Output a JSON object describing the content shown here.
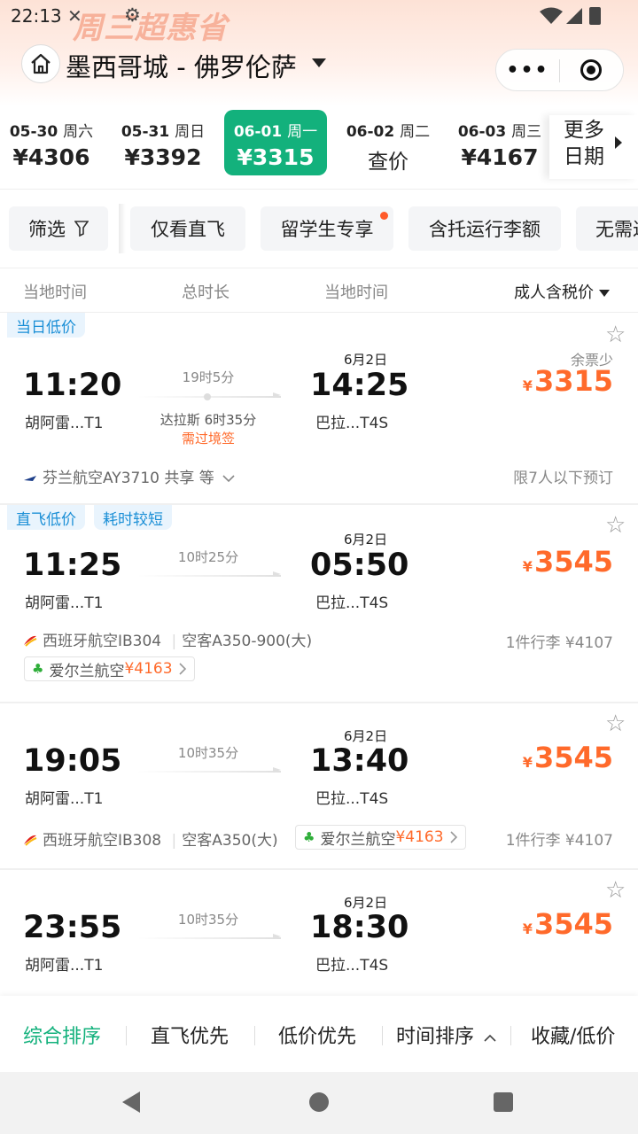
{
  "status": {
    "time": "22:13"
  },
  "header": {
    "promo": "周三超惠省",
    "title": "墨西哥城 - 佛罗伦萨"
  },
  "dates": [
    {
      "date": "05-30",
      "weekday": "周六",
      "price": "¥4306",
      "selected": false
    },
    {
      "date": "05-31",
      "weekday": "周日",
      "price": "¥3392",
      "selected": false
    },
    {
      "date": "06-01",
      "weekday": "周一",
      "price": "¥3315",
      "selected": true
    },
    {
      "date": "06-02",
      "weekday": "周二",
      "price": "查价",
      "selected": false
    },
    {
      "date": "06-03",
      "weekday": "周三",
      "price": "¥4167",
      "selected": false
    }
  ],
  "more_dates": {
    "line1": "更多",
    "line2": "日期"
  },
  "filters": [
    "筛选",
    "仅看直飞",
    "留学生专享",
    "含托运行李额",
    "无需过境签"
  ],
  "columns": {
    "dep": "当地时间",
    "dur": "总时长",
    "arr": "当地时间",
    "price": "成人含税价"
  },
  "flights": [
    {
      "tags": [
        "当日低价"
      ],
      "dep_time": "11:20",
      "dep_airport": "胡阿雷...T1",
      "duration": "19时5分",
      "stop": "达拉斯 6时35分",
      "visa": "需过境签",
      "arr_date": "6月2日",
      "arr_time": "14:25",
      "arr_airport": "巴拉...T4S",
      "price_note": "余票少",
      "currency": "¥",
      "price": "3315",
      "airline": "芬兰航空AY3710 共享 等",
      "right_info": "限7人以下预订"
    },
    {
      "tags": [
        "直飞低价",
        "耗时较短"
      ],
      "dep_time": "11:25",
      "dep_airport": "胡阿雷...T1",
      "duration": "10时25分",
      "arr_date": "6月2日",
      "arr_time": "05:50",
      "arr_airport": "巴拉...T4S",
      "currency": "¥",
      "price": "3545",
      "airline": "西班牙航空IB304",
      "aircraft": "空客A350-900(大)",
      "alt_airline": "爱尔兰航空",
      "alt_price": "¥4163",
      "right_info": "1件行李 ¥4107"
    },
    {
      "dep_time": "19:05",
      "dep_airport": "胡阿雷...T1",
      "duration": "10时35分",
      "arr_date": "6月2日",
      "arr_time": "13:40",
      "arr_airport": "巴拉...T4S",
      "currency": "¥",
      "price": "3545",
      "airline": "西班牙航空IB308",
      "aircraft": "空客A350(大)",
      "alt_airline": "爱尔兰航空",
      "alt_price": "¥4163",
      "right_info": "1件行李 ¥4107"
    },
    {
      "dep_time": "23:55",
      "dep_airport": "胡阿雷...T1",
      "duration": "10时35分",
      "arr_date": "6月2日",
      "arr_time": "18:30",
      "arr_airport": "巴拉...T4S",
      "currency": "¥",
      "price": "3545"
    }
  ],
  "sort_bar": [
    "综合排序",
    "直飞优先",
    "低价优先",
    "时间排序",
    "收藏/低价"
  ],
  "colors": {
    "accent": "#13b17c",
    "price": "#ff6a2b",
    "tag": "#1b8fd6"
  }
}
